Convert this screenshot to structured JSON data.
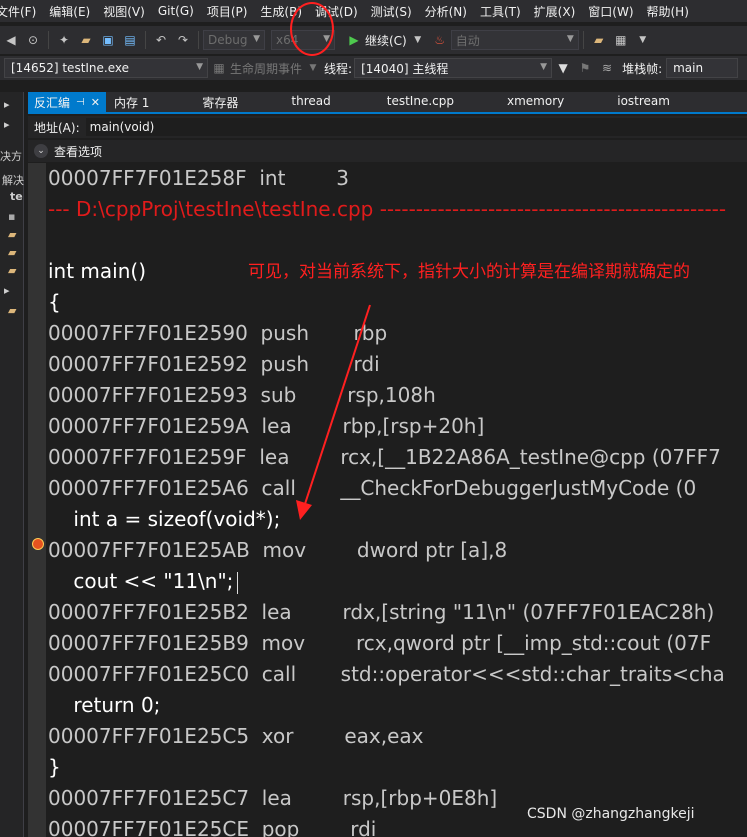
{
  "menu": [
    "文件(F)",
    "编辑(E)",
    "视图(V)",
    "Git(G)",
    "项目(P)",
    "生成(B)",
    "调试(D)",
    "测试(S)",
    "分析(N)",
    "工具(T)",
    "扩展(X)",
    "窗口(W)",
    "帮助(H)"
  ],
  "toolbar": {
    "config": "Debug",
    "platform": "x64",
    "continue_label": "继续(C)",
    "auto_label": "自动"
  },
  "toolbar2": {
    "process": "[14652] testIne.exe",
    "lifecycle_label": "生命周期事件",
    "thread_label": "线程:",
    "thread_value": "[14040] 主线程",
    "stack_label": "堆栈帧:",
    "stack_value": "main"
  },
  "left_panel": {
    "item1": "决方",
    "item2": "解决",
    "item3": "te"
  },
  "tabs": [
    "反汇编",
    "内存 1",
    "寄存器",
    "thread",
    "testIne.cpp",
    "xmemory",
    "iostream"
  ],
  "address": {
    "label": "地址(A):",
    "value": "main(void)"
  },
  "view_options": "查看选项",
  "code": {
    "line0": "00007FF7F01E258F  int        3",
    "line1": "--- D:\\cppProj\\testIne\\testIne.cpp ------------------------------------------------",
    "line2": "int main()",
    "line3": "{",
    "line4_addr": "00007FF7F01E2590  push       rbp",
    "line5_addr": "00007FF7F01E2592  push       rdi",
    "line6_addr": "00007FF7F01E2593  sub        rsp,108h",
    "line7_addr": "00007FF7F01E259A  lea        rbp,[rsp+20h]",
    "line8_addr": "00007FF7F01E259F  lea        rcx,[__1B22A86A_testIne@cpp (07FF7",
    "line9_addr": "00007FF7F01E25A6  call       __CheckForDebuggerJustMyCode (0",
    "line10": "    int a = sizeof(void*);",
    "line11_addr": "00007FF7F01E25AB  mov        dword ptr [a],8",
    "line12": "    cout << \"11\\n\";",
    "line13_addr": "00007FF7F01E25B2  lea        rdx,[string \"11\\n\" (07FF7F01EAC28h)",
    "line14_addr": "00007FF7F01E25B9  mov        rcx,qword ptr [__imp_std::cout (07F",
    "line15_addr": "00007FF7F01E25C0  call       std::operator<<<std::char_traits<cha",
    "line16": "    return 0;",
    "line17_addr": "00007FF7F01E25C5  xor        eax,eax",
    "line18": "}",
    "line19_addr": "00007FF7F01E25C7  lea        rsp,[rbp+0E8h]",
    "line20_addr": "00007FF7F01E25CE  pop        rdi"
  },
  "annotation": "可见，对当前系统下，指针大小的计算是在编译期就确定的",
  "watermark": "CSDN @zhangzhangkeji"
}
